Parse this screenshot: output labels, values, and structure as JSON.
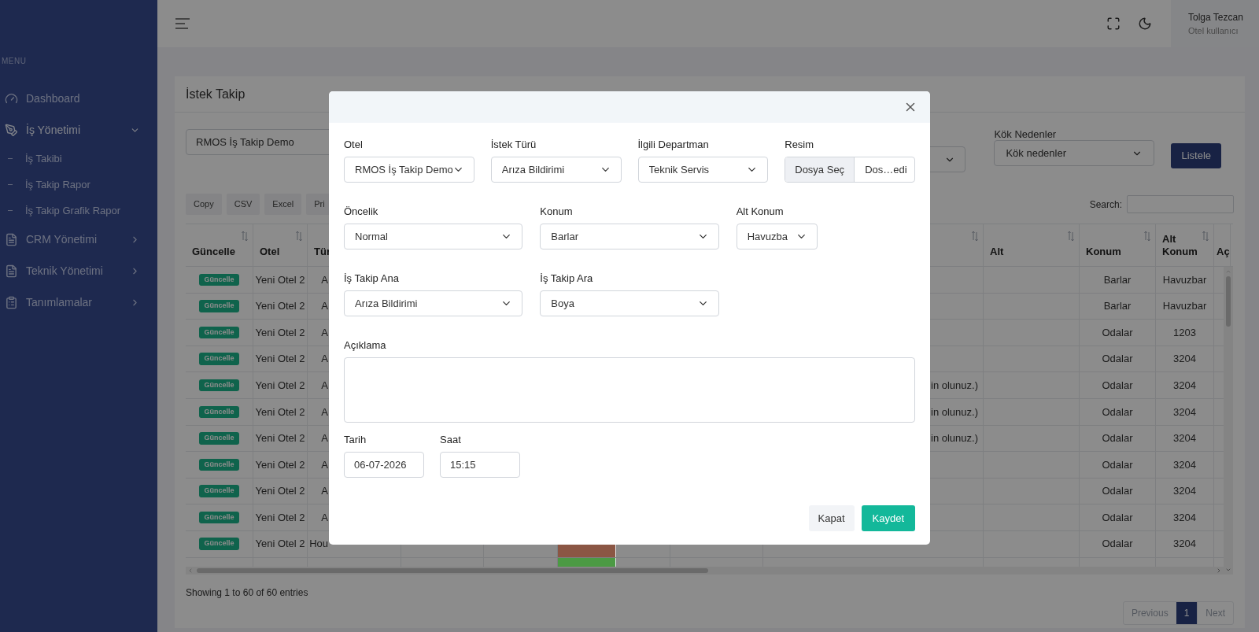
{
  "sidebar": {
    "heading": "MENU",
    "items": [
      {
        "label": "Dashboard",
        "expanded": false
      },
      {
        "label": "İş Yönetimi",
        "expanded": true,
        "children": [
          {
            "label": "İş Takibi"
          },
          {
            "label": "İş Takip Rapor"
          },
          {
            "label": "İş Takip Grafik Rapor"
          }
        ]
      },
      {
        "label": "CRM Yönetimi",
        "expanded": false
      },
      {
        "label": "Teknik Yönetimi",
        "expanded": false
      },
      {
        "label": "Tanımlamalar",
        "expanded": false
      }
    ]
  },
  "topbar": {
    "user_name": "Tolga Tezcan",
    "user_role": "Otel kullanıcı"
  },
  "page": {
    "title": "İstek Takip",
    "filters": {
      "hotel_select": "RMOS İş Takip Demo",
      "root_cause_label": "Kök Nedenler",
      "root_cause_select": "Kök nedenler",
      "list_button": "Listele"
    },
    "export_buttons": [
      "Copy",
      "CSV",
      "Excel",
      "Pri"
    ],
    "search_label": "Search:",
    "table": {
      "columns": [
        {
          "label": "Güncelle"
        },
        {
          "label": "Otel"
        },
        {
          "label": "Tür"
        },
        {
          "label": "Alt"
        },
        {
          "label": "Konum"
        },
        {
          "label": "Alt Konum"
        },
        {
          "label": "Aç"
        }
      ],
      "rows": [
        {
          "update": "Güncelle",
          "otel": "Yeni Otel 2",
          "tur": "A",
          "konum": "Barlar",
          "alt_konum": "Havuzbar"
        },
        {
          "update": "Güncelle",
          "otel": "Yeni Otel 2",
          "tur": "A",
          "konum": "Barlar",
          "alt_konum": "Havuzbar"
        },
        {
          "update": "Güncelle",
          "otel": "Yeni Otel 2",
          "tur": "A",
          "konum": "Odalar",
          "alt_konum": "1203"
        },
        {
          "update": "Güncelle",
          "otel": "Yeni Otel 2",
          "tur": "A",
          "konum": "Odalar",
          "alt_konum": "3204"
        },
        {
          "update": "Güncelle",
          "otel": "Yeni Otel 2",
          "tur": "A",
          "aciklama": "in olunuz.)",
          "konum": "Odalar",
          "alt_konum": "3204"
        },
        {
          "update": "Güncelle",
          "otel": "Yeni Otel 2",
          "tur": "A",
          "aciklama": "in olunuz.)",
          "konum": "Odalar",
          "alt_konum": "3204"
        },
        {
          "update": "Güncelle",
          "otel": "Yeni Otel 2",
          "tur": "A",
          "aciklama": "in olunuz.)",
          "konum": "Odalar",
          "alt_konum": "3204"
        },
        {
          "update": "Güncelle",
          "otel": "Yeni Otel 2",
          "tur": "A",
          "konum": "Odalar",
          "alt_konum": "3204"
        },
        {
          "update": "Güncelle",
          "otel": "Yeni Otel 2",
          "tur": "A",
          "konum": "Odalar",
          "alt_konum": "3204"
        },
        {
          "update": "Güncelle",
          "otel": "Yeni Otel 2",
          "tur": "A",
          "konum": "Odalar",
          "alt_konum": "3204"
        },
        {
          "update": "Güncelle",
          "otel": "Yeni Otel 2",
          "tur": "Hou",
          "color": "#8b5644",
          "konum": "Odalar",
          "alt_konum": "3204"
        },
        {
          "color": "#4c9a44"
        }
      ]
    },
    "entries_info": "Showing 1 to 60 of 60 entries",
    "pagination": {
      "previous": "Previous",
      "next": "Next",
      "previous_disabled": true,
      "next_disabled": true,
      "pages": [
        {
          "label": "1",
          "selected": true
        }
      ]
    }
  },
  "modal": {
    "fields": [
      {
        "kind": "select",
        "label": "Otel",
        "value": "RMOS İş Takip Demo"
      },
      {
        "kind": "select",
        "label": "İstek Türü",
        "value": "Arıza Bildirimi"
      },
      {
        "kind": "select",
        "label": "İlgili Departman",
        "value": "Teknik Servis"
      },
      {
        "kind": "file",
        "label": "Resim",
        "button": "Dosya Seç",
        "value": "Dos…edi"
      },
      {
        "kind": "select",
        "label": "Öncelik",
        "value": "Normal"
      },
      {
        "kind": "select",
        "label": "Konum",
        "value": "Barlar"
      },
      {
        "kind": "select",
        "label": "Alt Konum",
        "value": "Havuzba"
      },
      {
        "kind": "select",
        "label": "İş Takip Ana",
        "value": "Arıza Bildirimi"
      },
      {
        "kind": "select",
        "label": "İş Takip Ara",
        "value": "Boya"
      },
      {
        "kind": "textarea",
        "label": "Açıklama"
      },
      {
        "kind": "input",
        "label": "Tarih",
        "value": "06-07-2026"
      },
      {
        "kind": "input",
        "label": "Saat",
        "value": "15:15"
      }
    ],
    "buttons": [
      {
        "label": "Kapat",
        "kind": "secondary"
      },
      {
        "label": "Kaydet",
        "kind": "primary"
      }
    ]
  }
}
